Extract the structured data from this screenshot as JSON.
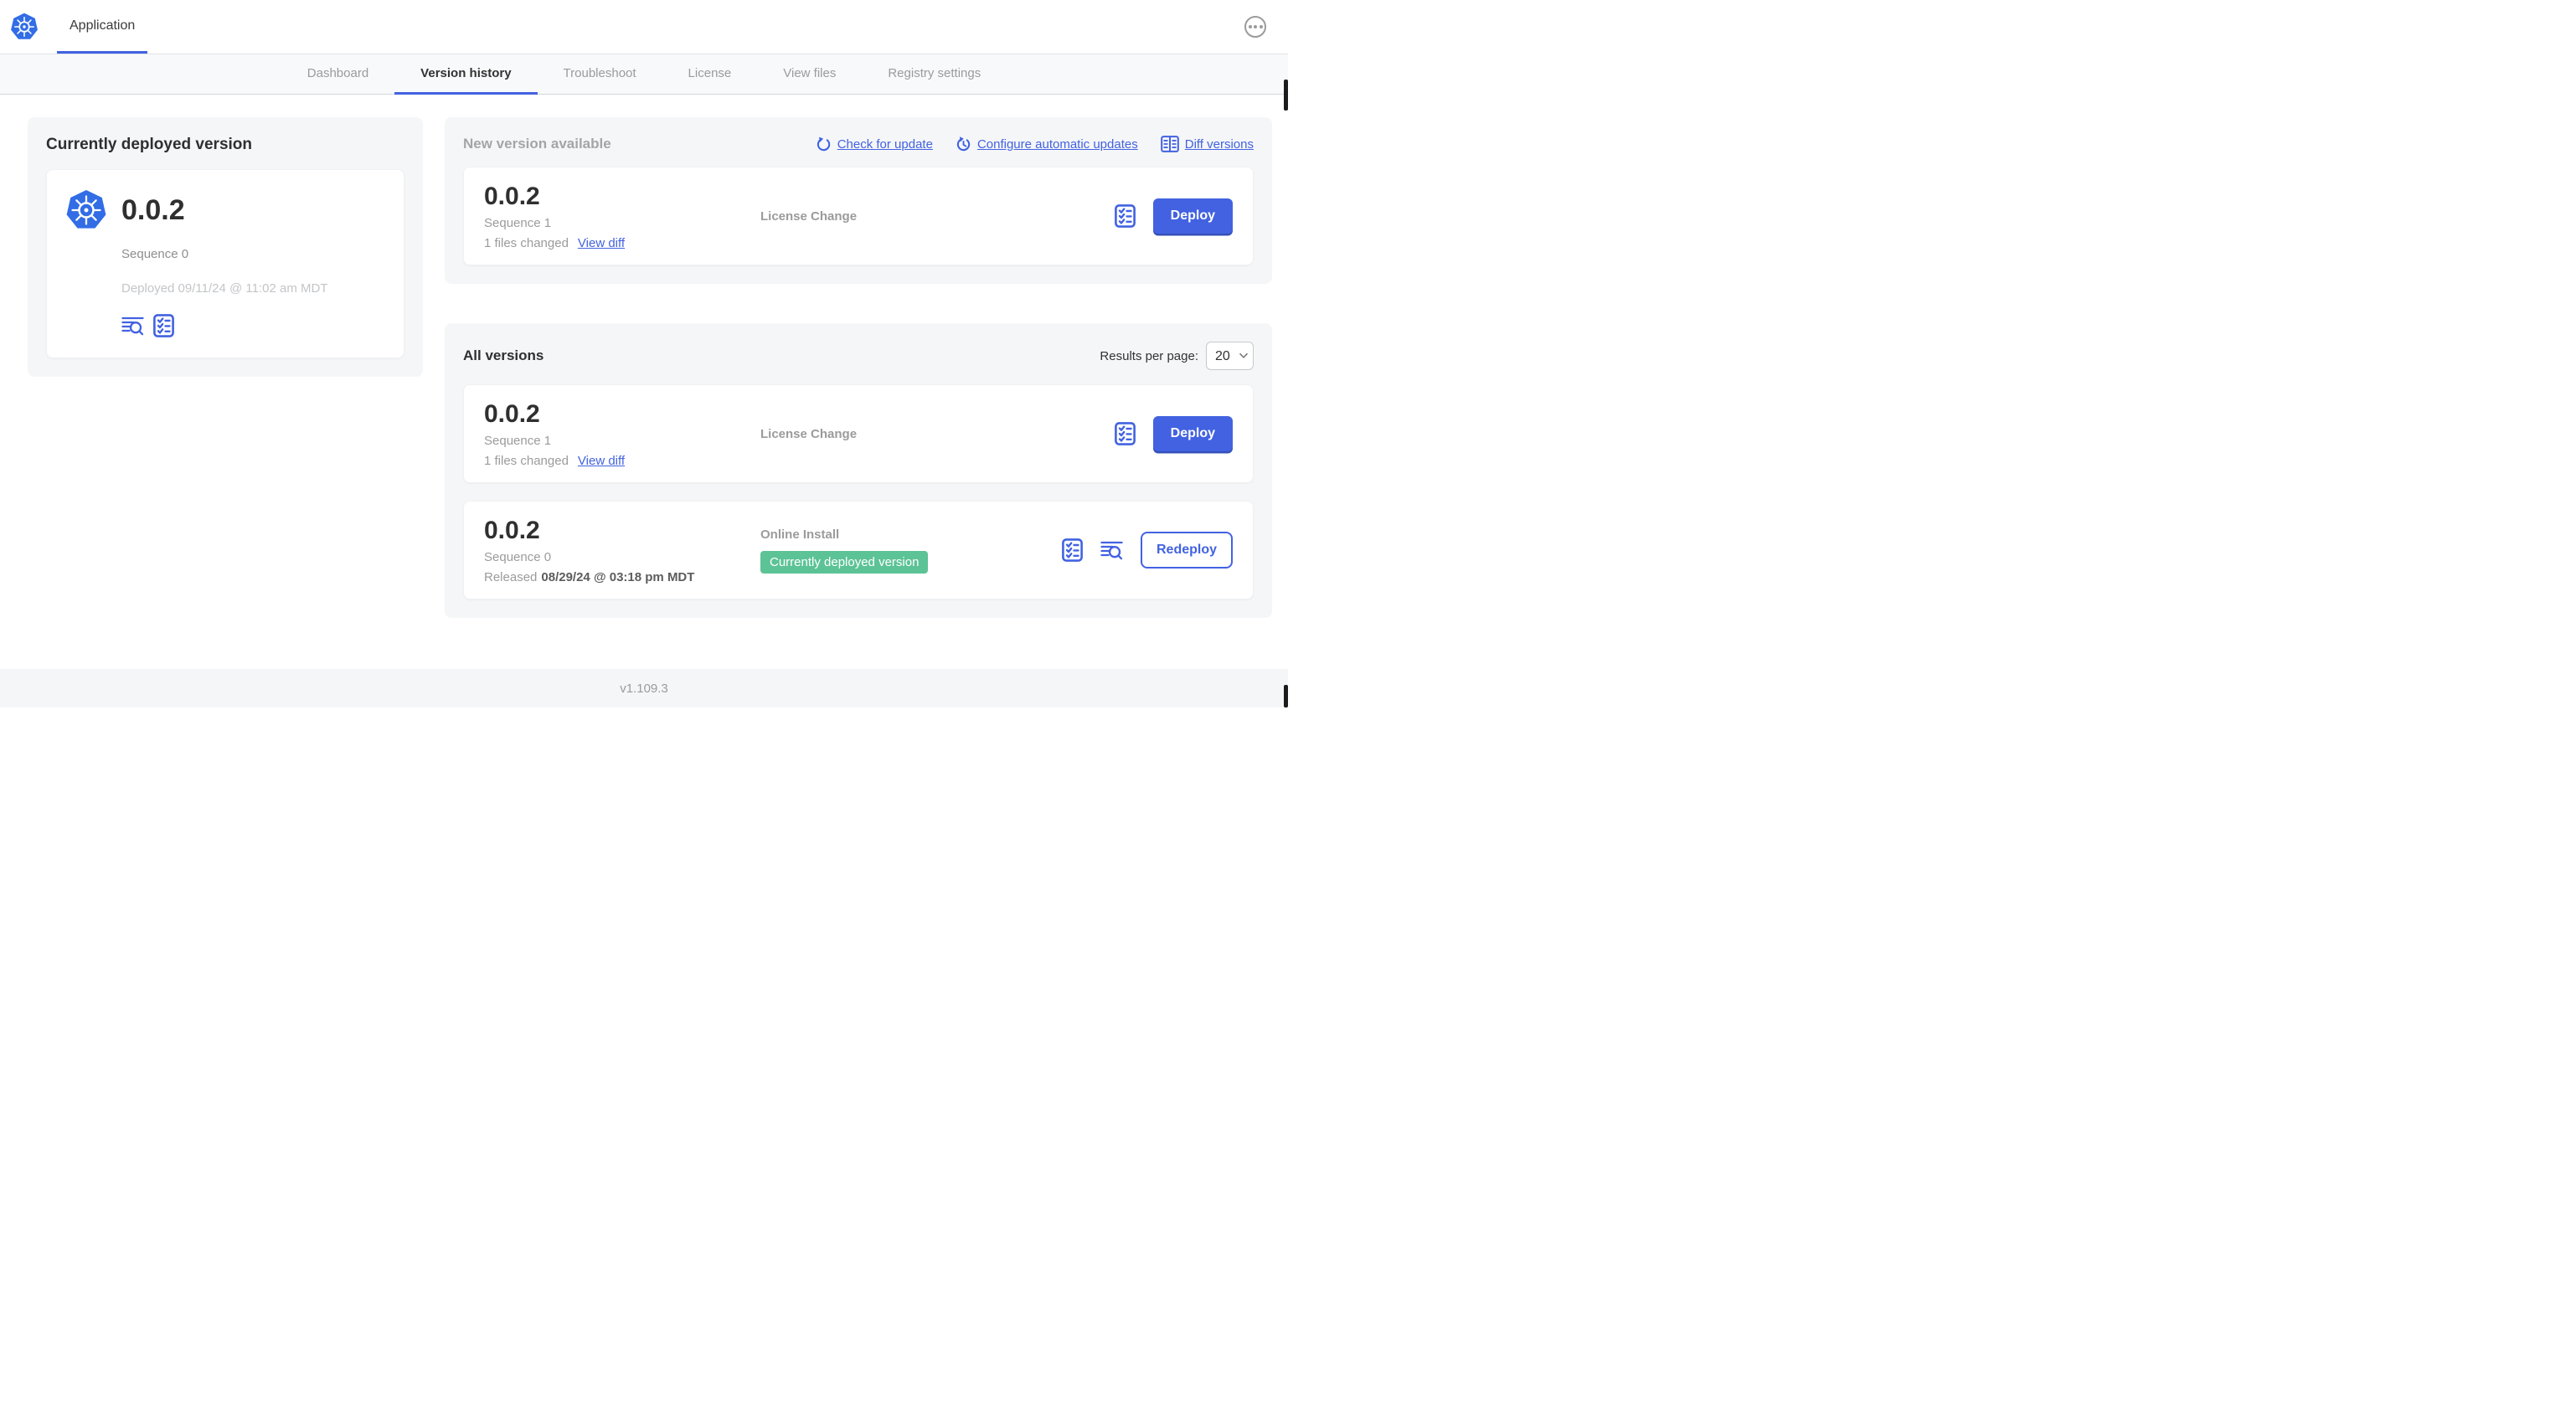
{
  "app": {
    "title": "Application",
    "footer_version": "v1.109.3"
  },
  "colors": {
    "primary_blue": "#4262e1",
    "kubernetes_blue": "#326de6",
    "badge_green": "#5cc396",
    "muted_gray": "#9b9b9b"
  },
  "nav": {
    "tabs": [
      {
        "label": "Dashboard",
        "active": false
      },
      {
        "label": "Version history",
        "active": true
      },
      {
        "label": "Troubleshoot",
        "active": false
      },
      {
        "label": "License",
        "active": false
      },
      {
        "label": "View files",
        "active": false
      },
      {
        "label": "Registry settings",
        "active": false
      }
    ]
  },
  "current_version_card": {
    "title": "Currently deployed version",
    "version": "0.0.2",
    "sequence": "Sequence 0",
    "deployed": "Deployed 09/11/24 @ 11:02 am MDT",
    "icons": [
      "logs-icon",
      "checklist-icon"
    ]
  },
  "new_version_section": {
    "title": "New version available",
    "actions": [
      {
        "label": "Check for update",
        "icon": "refresh-icon"
      },
      {
        "label": "Configure automatic updates",
        "icon": "clock-refresh-icon"
      },
      {
        "label": "Diff versions",
        "icon": "diff-icon"
      }
    ],
    "row": {
      "version": "0.0.2",
      "sequence": "Sequence 1",
      "files_changed": "1 files changed",
      "view_diff_label": "View diff",
      "source": "License Change",
      "action_label": "Deploy"
    }
  },
  "all_versions_section": {
    "title": "All versions",
    "results_per_page_label": "Results per page:",
    "results_per_page_value": "20",
    "rows": [
      {
        "version": "0.0.2",
        "sequence": "Sequence 1",
        "files_changed": "1 files changed",
        "view_diff_label": "View diff",
        "source": "License Change",
        "action_label": "Deploy"
      },
      {
        "version": "0.0.2",
        "sequence": "Sequence 0",
        "released_prefix": "Released",
        "released_date": "08/29/24 @ 03:18 pm MDT",
        "source": "Online Install",
        "badge": "Currently deployed version",
        "action_label": "Redeploy"
      }
    ]
  }
}
